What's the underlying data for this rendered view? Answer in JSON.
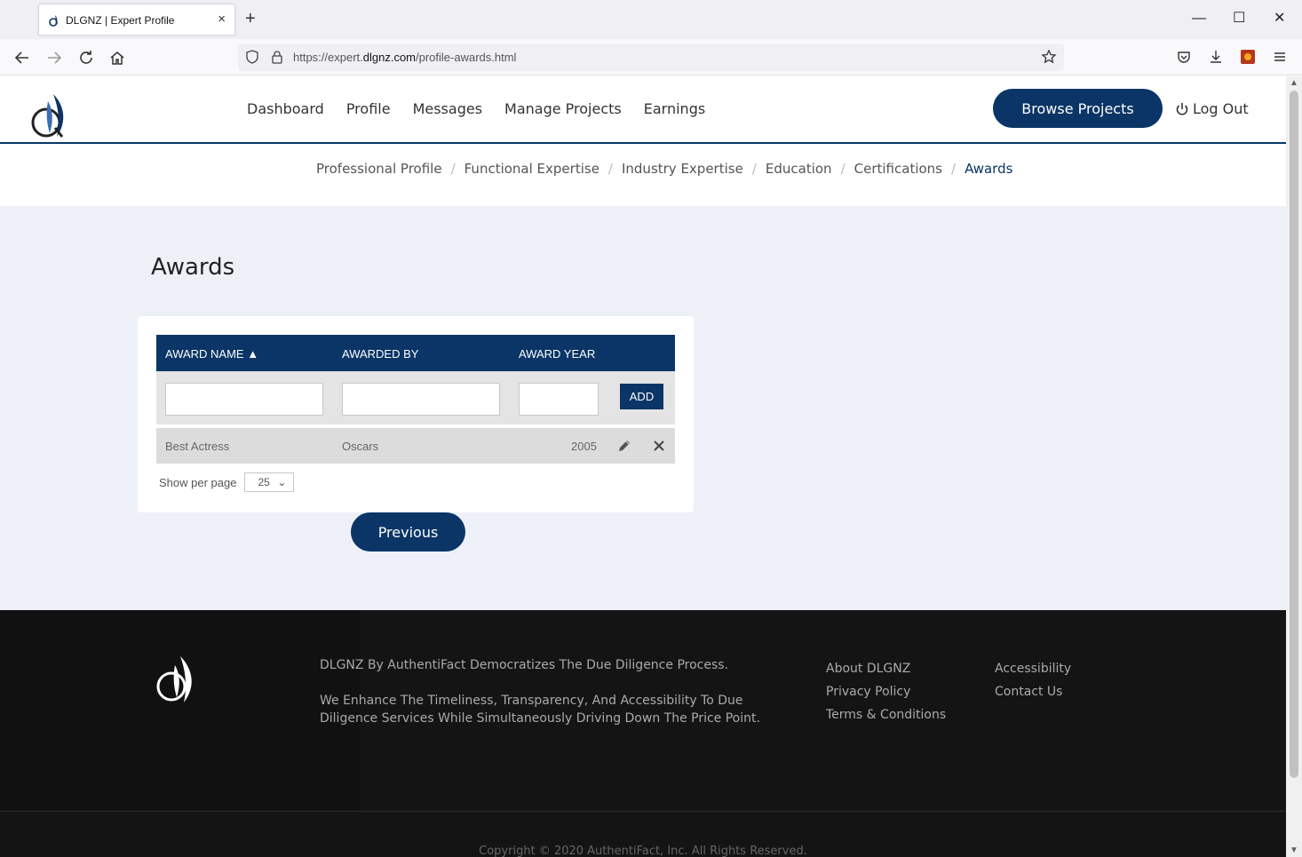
{
  "browser": {
    "tab_title": "DLGNZ | Expert Profile",
    "tab_close": "×",
    "new_tab": "+",
    "url_prefix": "https://expert.",
    "url_domain": "dlgnz.com",
    "url_path": "/profile-awards.html",
    "window_minimize": "—",
    "window_maximize": "☐",
    "window_close": "✕"
  },
  "header": {
    "nav": [
      "Dashboard",
      "Profile",
      "Messages",
      "Manage Projects",
      "Earnings"
    ],
    "browse_label": "Browse Projects",
    "logout_label": "Log Out"
  },
  "breadcrumb": {
    "items": [
      "Professional Profile",
      "Functional Expertise",
      "Industry Expertise",
      "Education",
      "Certifications",
      "Awards"
    ],
    "separator": "/"
  },
  "main": {
    "title": "Awards",
    "table": {
      "columns": [
        "AWARD NAME",
        "AWARDED BY",
        "AWARD YEAR"
      ],
      "sort_indicator": "▲",
      "add_label": "ADD",
      "rows": [
        {
          "name": "Best Actress",
          "by": "Oscars",
          "year": "2005"
        }
      ]
    },
    "per_page_label": "Show per page",
    "per_page_value": "25",
    "per_page_chevron": "⌄",
    "previous_label": "Previous"
  },
  "footer": {
    "tagline": "DLGNZ By AuthentiFact Democratizes The Due Diligence Process.",
    "description": "We Enhance The Timeliness, Transparency, And Accessibility To Due Diligence Services While Simultaneously Driving Down The Price Point.",
    "col1": [
      "About DLGNZ",
      "Privacy Policy",
      "Terms & Conditions"
    ],
    "col2": [
      "Accessibility",
      "Contact Us"
    ],
    "copyright": "Copyright © 2020 AuthentiFact, Inc. All Rights Reserved."
  },
  "colors": {
    "brand_navy": "#0a3566",
    "content_bg": "#edf1f7",
    "footer_bg": "#141414"
  },
  "icons": [
    "back-icon",
    "forward-icon",
    "reload-icon",
    "home-icon",
    "shield-icon",
    "lock-icon",
    "star-icon",
    "pocket-icon",
    "download-icon",
    "extension-icon",
    "menu-icon",
    "power-icon",
    "pencil-icon",
    "close-icon"
  ]
}
